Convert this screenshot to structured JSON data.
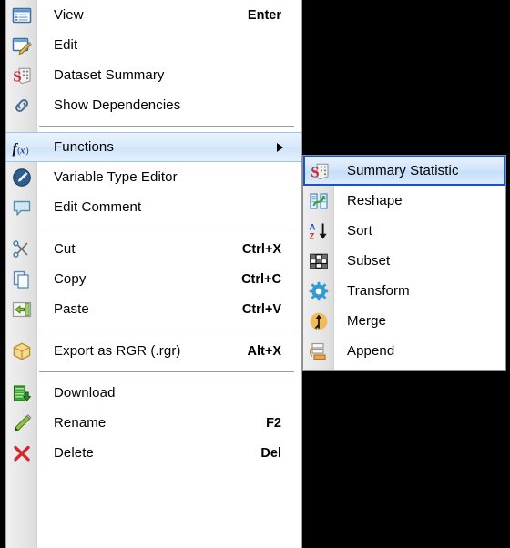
{
  "context_menu": {
    "name": "dataset-context-menu",
    "groups": [
      {
        "items": [
          {
            "label": "View",
            "accel": "Enter",
            "icon": "view-list-icon",
            "highlighted": false,
            "submenu": false
          },
          {
            "label": "Edit",
            "accel": "",
            "icon": "edit-pencil-window-icon",
            "highlighted": false,
            "submenu": false
          },
          {
            "label": "Dataset Summary",
            "accel": "",
            "icon": "summary-s-dice-icon",
            "highlighted": false,
            "submenu": false
          },
          {
            "label": "Show Dependencies",
            "accel": "",
            "icon": "chain-link-icon",
            "highlighted": false,
            "submenu": false
          }
        ]
      },
      {
        "items": [
          {
            "label": "Functions",
            "accel": "",
            "icon": "fx-function-icon",
            "highlighted": true,
            "submenu": true
          },
          {
            "label": "Variable Type Editor",
            "accel": "",
            "icon": "blue-circle-pencil-icon",
            "highlighted": false,
            "submenu": false
          },
          {
            "label": "Edit Comment",
            "accel": "",
            "icon": "speech-bubble-icon",
            "highlighted": false,
            "submenu": false
          }
        ]
      },
      {
        "items": [
          {
            "label": "Cut",
            "accel": "Ctrl+X",
            "icon": "scissors-icon",
            "highlighted": false,
            "submenu": false
          },
          {
            "label": "Copy",
            "accel": "Ctrl+C",
            "icon": "copy-pages-icon",
            "highlighted": false,
            "submenu": false
          },
          {
            "label": "Paste",
            "accel": "Ctrl+V",
            "icon": "paste-arrow-icon",
            "highlighted": false,
            "submenu": false
          }
        ]
      },
      {
        "items": [
          {
            "label": "Export as RGR (.rgr)",
            "accel": "Alt+X",
            "icon": "gold-box-icon",
            "highlighted": false,
            "submenu": false
          }
        ]
      },
      {
        "items": [
          {
            "label": "Download",
            "accel": "",
            "icon": "green-download-icon",
            "highlighted": false,
            "submenu": false
          },
          {
            "label": "Rename",
            "accel": "F2",
            "icon": "green-pencil-icon",
            "highlighted": false,
            "submenu": false
          },
          {
            "label": "Delete",
            "accel": "Del",
            "icon": "red-x-icon",
            "highlighted": false,
            "submenu": false
          }
        ]
      }
    ]
  },
  "submenu": {
    "name": "functions-submenu",
    "parent_item": "Functions",
    "items": [
      {
        "label": "Summary Statistic",
        "icon": "summary-s-dice-icon",
        "highlighted": true
      },
      {
        "label": "Reshape",
        "icon": "reshape-arrow-icon",
        "highlighted": false
      },
      {
        "label": "Sort",
        "icon": "sort-az-icon",
        "highlighted": false
      },
      {
        "label": "Subset",
        "icon": "subset-grid-icon",
        "highlighted": false
      },
      {
        "label": "Transform",
        "icon": "transform-gear-icon",
        "highlighted": false
      },
      {
        "label": "Merge",
        "icon": "merge-arrow-icon",
        "highlighted": false
      },
      {
        "label": "Append",
        "icon": "append-stack-icon",
        "highlighted": false
      }
    ]
  },
  "colors": {
    "menu_background": "#ffffff",
    "gutter_background": "#e6e6e6",
    "highlight_fill": "#d7e9fb",
    "highlight_border": "#9dc4ee",
    "submenu_selection_border": "#1b54c9",
    "text": "#000000",
    "separator": "#9b9b9b",
    "page_background": "#000000"
  }
}
